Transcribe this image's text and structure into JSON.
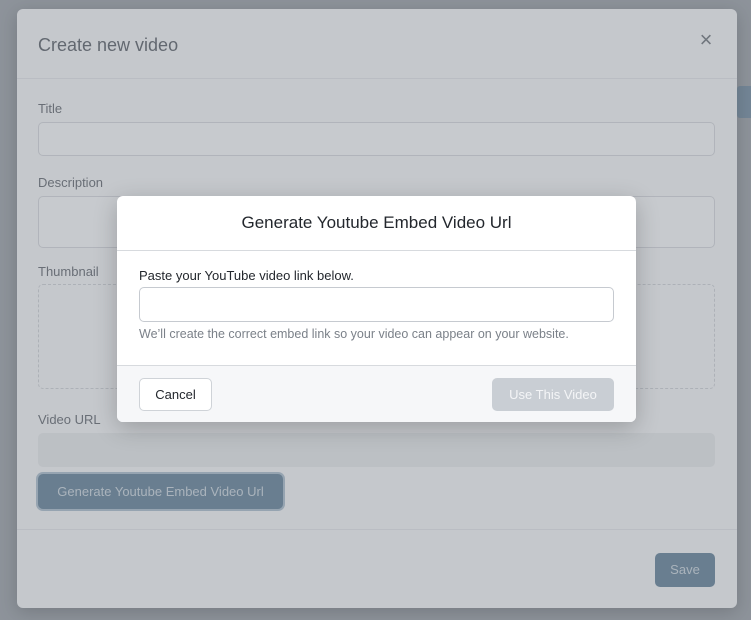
{
  "parent_modal": {
    "title": "Create new video",
    "close_icon": "×",
    "fields": {
      "title_label": "Title",
      "description_label": "Description",
      "thumbnail_label": "Thumbnail",
      "video_url_label": "Video URL"
    },
    "generate_button_label": "Generate Youtube Embed Video Url",
    "save_button_label": "Save"
  },
  "dialog": {
    "title": "Generate Youtube Embed Video Url",
    "input_label": "Paste your YouTube video link below.",
    "input_value": "",
    "input_placeholder": "",
    "help_text": "We’ll create the correct embed link so your video can appear on your website.",
    "cancel_label": "Cancel",
    "use_label": "Use This Video"
  },
  "colors": {
    "primary_button": "#5f7f96",
    "disabled_button": "#c9ced4"
  }
}
